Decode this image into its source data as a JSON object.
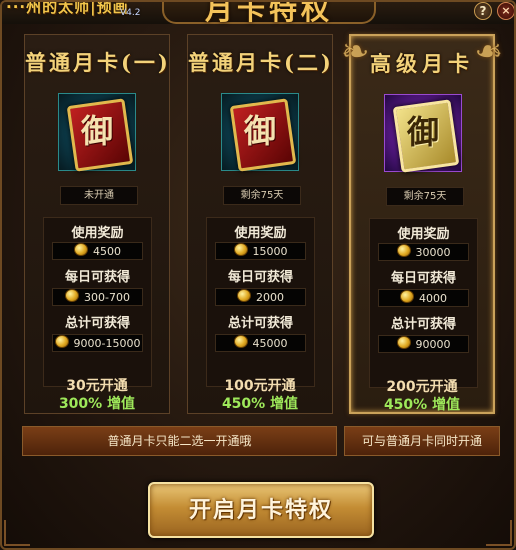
{
  "header": {
    "left_text": "···州的太师|预画",
    "left_sub": "V4.2",
    "title": "月卡特权",
    "help_label": "?",
    "close_label": "×"
  },
  "cards": [
    {
      "name": "普通月卡(一)",
      "art_glyph": "御",
      "status": "未开通",
      "rewards": [
        {
          "label": "使用奖励",
          "value": "4500"
        },
        {
          "label": "每日可获得",
          "value": "300-700"
        },
        {
          "label": "总计可获得",
          "value": "9000-15000"
        }
      ],
      "price": "30元开通",
      "boost": "300% 增值"
    },
    {
      "name": "普通月卡(二)",
      "art_glyph": "御",
      "status": "剩余75天",
      "rewards": [
        {
          "label": "使用奖励",
          "value": "15000"
        },
        {
          "label": "每日可获得",
          "value": "2000"
        },
        {
          "label": "总计可获得",
          "value": "45000"
        }
      ],
      "price": "100元开通",
      "boost": "450% 增值"
    },
    {
      "name": "高级月卡",
      "art_glyph": "御",
      "status": "剩余75天",
      "rewards": [
        {
          "label": "使用奖励",
          "value": "30000"
        },
        {
          "label": "每日可获得",
          "value": "4000"
        },
        {
          "label": "总计可获得",
          "value": "90000"
        }
      ],
      "price": "200元开通",
      "boost": "450% 增值"
    }
  ],
  "notes": {
    "normal": "普通月卡只能二选一开通哦",
    "premium": "可与普通月卡同时开通"
  },
  "open_button": "开启月卡特权",
  "colors": {
    "title_gold": "#f4c35a",
    "boost_green": "#9ee85a",
    "premium_border": "#caa25a"
  }
}
